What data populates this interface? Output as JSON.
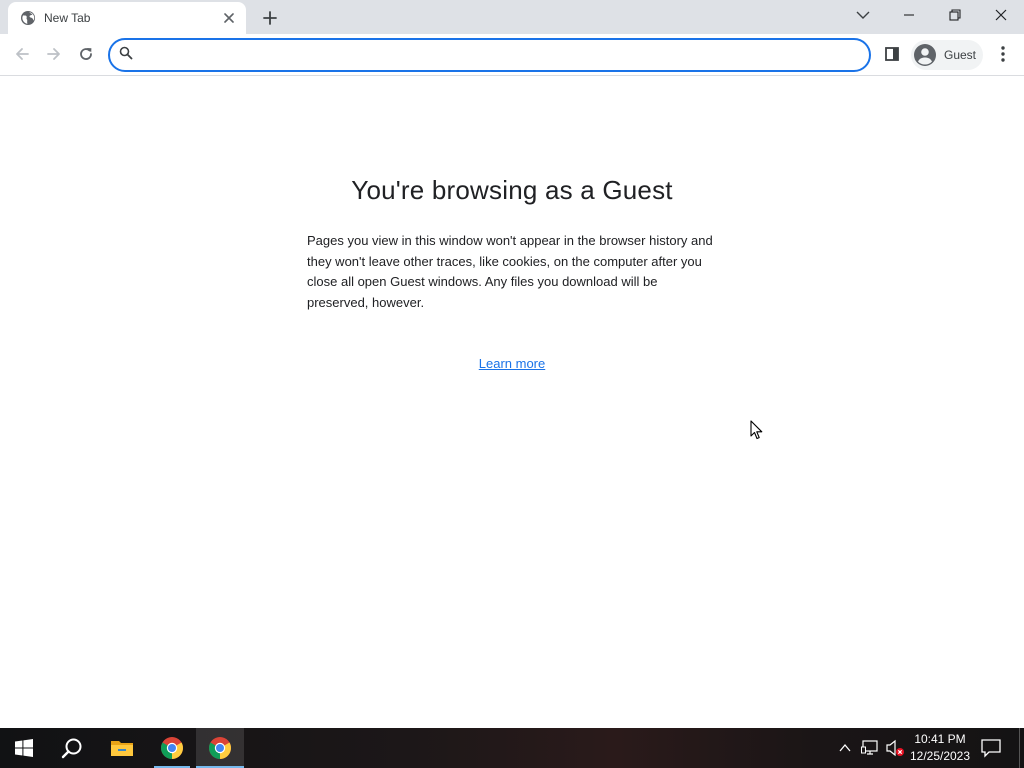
{
  "browser": {
    "tab": {
      "title": "New Tab",
      "favicon": "globe-icon"
    },
    "omnibox": {
      "value": "",
      "placeholder": ""
    },
    "profile": {
      "label": "Guest",
      "icon": "account-circle-icon"
    },
    "accent": "#1a73e8"
  },
  "page": {
    "title": "You're browsing as a Guest",
    "description": "Pages you view in this window won't appear in the browser history and they won't leave other traces, like cookies, on the computer after you close all open Guest windows. Any files you download will be preserved, however.",
    "learn_more": "Learn more"
  },
  "taskbar": {
    "apps": [
      "windows-start-icon",
      "search-icon",
      "file-explorer-icon",
      "chrome-icon",
      "chrome-icon"
    ],
    "clock": {
      "time": "10:41 PM",
      "date": "12/25/2023"
    }
  }
}
